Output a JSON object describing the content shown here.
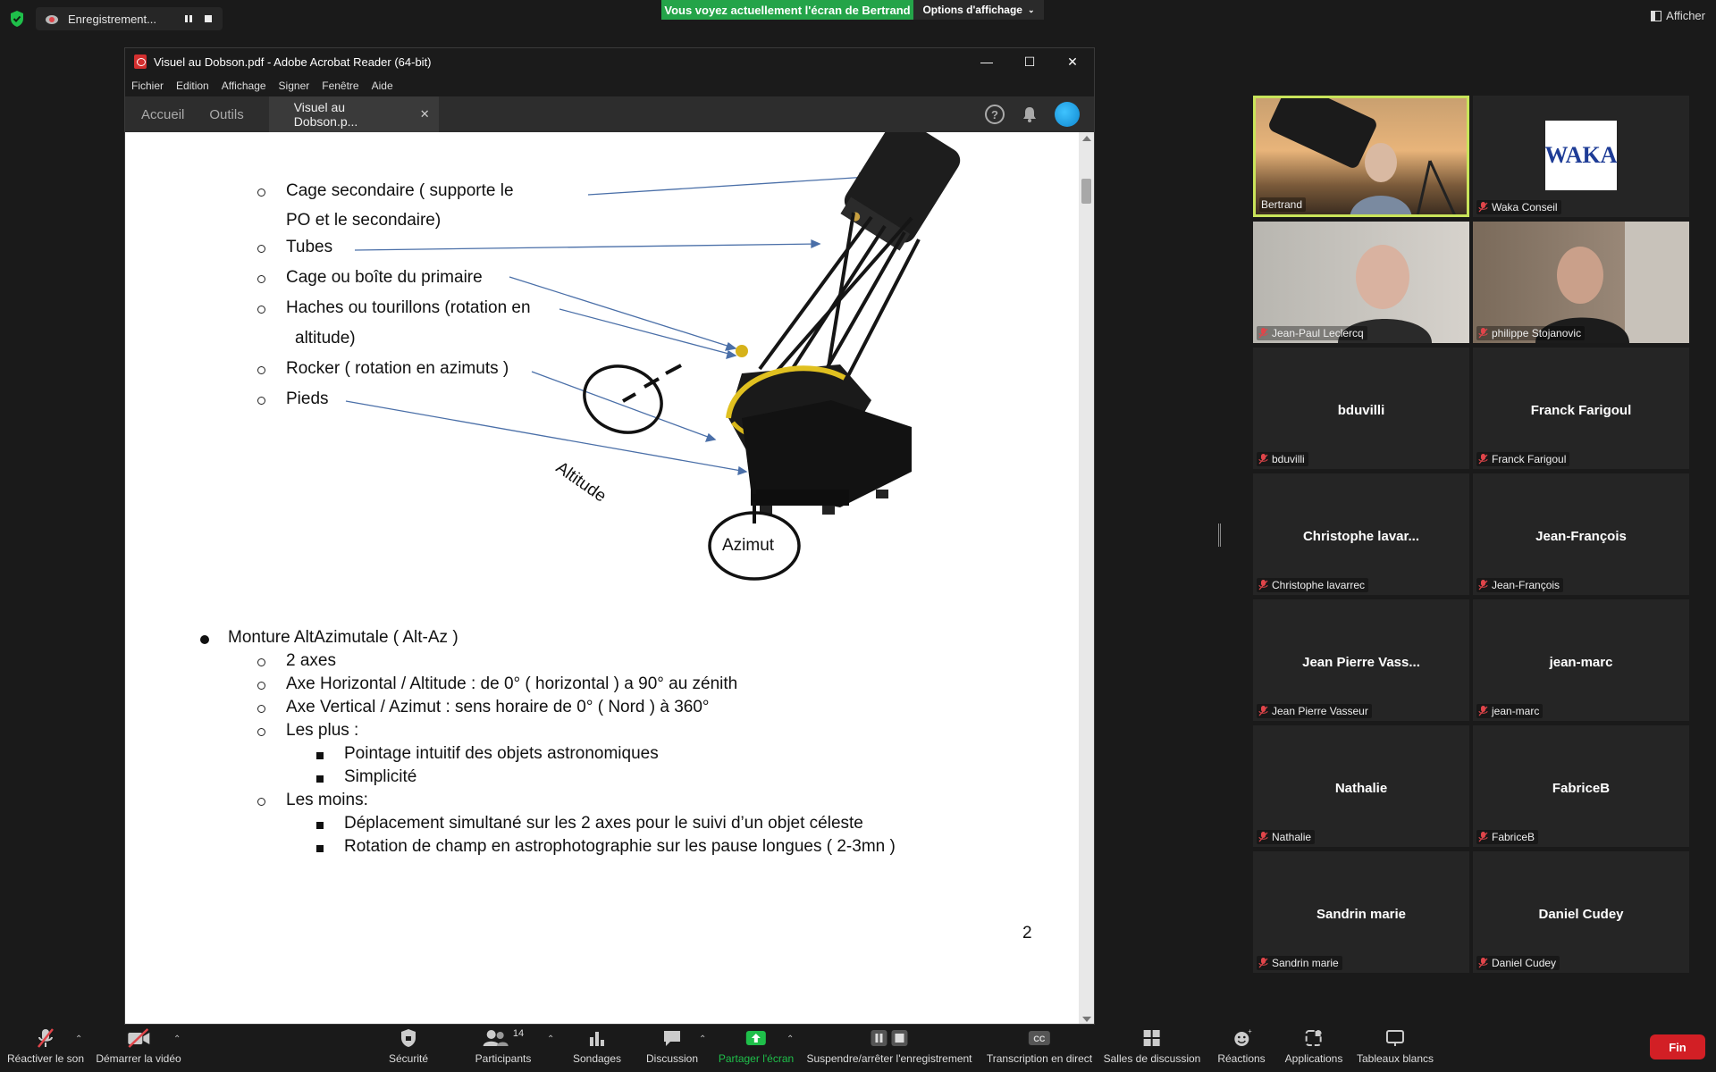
{
  "top": {
    "recording_label": "Enregistrement...",
    "banner": "Vous voyez actuellement l'écran de Bertrand",
    "view_options": "Options d'affichage",
    "show_label": "Afficher"
  },
  "acrobat": {
    "title": "Visuel au Dobson.pdf - Adobe Acrobat Reader (64-bit)",
    "menu": [
      "Fichier",
      "Edition",
      "Affichage",
      "Signer",
      "Fenêtre",
      "Aide"
    ],
    "tabs": {
      "home": "Accueil",
      "tools": "Outils",
      "document": "Visuel au Dobson.p..."
    }
  },
  "pdf": {
    "parts_list": [
      "Cage secondaire ( supporte le",
      "PO  et le secondaire)",
      "Tubes",
      "Cage ou boîte du primaire",
      "Haches ou tourillons (rotation en",
      "altitude)",
      "Rocker ( rotation en azimuts )",
      "Pieds"
    ],
    "label_altitude": "Altitude",
    "label_azimut": "Azimut",
    "mount_title": "Monture AltAzimutale ( Alt-Az )",
    "mount_items": [
      "2 axes",
      "Axe Horizontal / Altitude : de 0° ( horizontal ) a 90° au zénith",
      "Axe Vertical / Azimut : sens horaire de 0° ( Nord ) à 360°",
      "Les plus :",
      "Pointage intuitif des objets astronomiques",
      "Simplicité",
      "Les moins:",
      "Déplacement simultané sur les 2 axes pour le suivi d’un objet céleste",
      "Rotation de champ en astrophotographie sur les pause longues ( 2-3mn )"
    ],
    "page_number": "2"
  },
  "participants": [
    {
      "label": "Bertrand",
      "type": "video",
      "muted": false,
      "active": true
    },
    {
      "label": "Waka Conseil",
      "type": "logo",
      "logo_text": "WAKA",
      "muted": true
    },
    {
      "label": "Jean-Paul Leclercq",
      "type": "video",
      "muted": true
    },
    {
      "label": "philippe Stojanovic",
      "type": "video",
      "muted": true
    },
    {
      "display": "bduvilli",
      "label": "bduvilli",
      "muted": true
    },
    {
      "display": "Franck Farigoul",
      "label": "Franck Farigoul",
      "muted": true
    },
    {
      "display": "Christophe lavar...",
      "label": "Christophe lavarrec",
      "muted": true
    },
    {
      "display": "Jean-François",
      "label": "Jean-François",
      "muted": true
    },
    {
      "display": "Jean Pierre Vass...",
      "label": "Jean Pierre Vasseur",
      "muted": true
    },
    {
      "display": "jean-marc",
      "label": "jean-marc",
      "muted": true
    },
    {
      "display": "Nathalie",
      "label": "Nathalie",
      "muted": true
    },
    {
      "display": "FabriceB",
      "label": "FabriceB",
      "muted": true
    },
    {
      "display": "Sandrin marie",
      "label": "Sandrin marie",
      "muted": true
    },
    {
      "display": "Daniel Cudey",
      "label": "Daniel Cudey",
      "muted": true
    }
  ],
  "toolbar": {
    "unmute": "Réactiver le son",
    "start_video": "Démarrer la vidéo",
    "security": "Sécurité",
    "participants": "Participants",
    "participants_count": "14",
    "polls": "Sondages",
    "chat": "Discussion",
    "share_screen": "Partager l'écran",
    "pause_recording": "Suspendre/arrêter l'enregistrement",
    "live_transcript": "Transcription en direct",
    "breakout_rooms": "Salles de discussion",
    "reactions": "Réactions",
    "apps": "Applications",
    "whiteboards": "Tableaux blancs",
    "end": "Fin"
  },
  "colors": {
    "banner_green": "#24a449",
    "end_red": "#d21f25",
    "active_speaker": "#c9e45a",
    "share_green": "#1fbf4a"
  }
}
